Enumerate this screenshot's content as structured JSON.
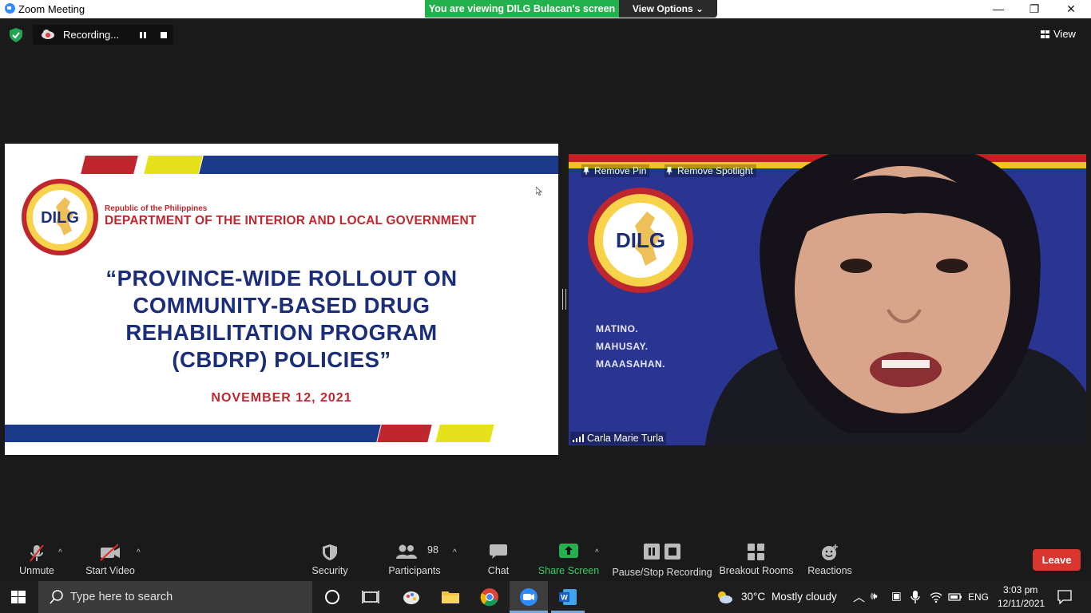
{
  "window": {
    "title": "Zoom Meeting",
    "viewing_banner": "You are viewing DILG Bulacan's screen",
    "view_options": "View Options",
    "minimize": "—",
    "restore": "❐",
    "close": "✕"
  },
  "recording": {
    "label": "Recording..."
  },
  "view_button": {
    "label": "View"
  },
  "slide": {
    "seal_text": "DILG",
    "republic": "Republic of the Philippines",
    "department": "DEPARTMENT OF THE INTERIOR AND LOCAL GOVERNMENT",
    "headline_lines": [
      "“PROVINCE-WIDE ROLLOUT ON",
      "COMMUNITY-BASED DRUG",
      "REHABILITATION PROGRAM",
      "(CBDRP) POLICIES”"
    ],
    "date": "NOVEMBER 12, 2021"
  },
  "video": {
    "seal_text": "DILG",
    "motto": [
      "MATINO.",
      "MAHUSAY.",
      "MAAASAHAN."
    ],
    "remove_pin": "Remove Pin",
    "remove_spotlight": "Remove Spotlight",
    "participant_name": "Carla Marie Turla"
  },
  "toolbar": {
    "unmute": "Unmute",
    "start_video": "Start Video",
    "security": "Security",
    "participants": "Participants",
    "participants_count": "98",
    "chat": "Chat",
    "share_screen": "Share Screen",
    "pause_stop": "Pause/Stop Recording",
    "breakout": "Breakout Rooms",
    "reactions": "Reactions",
    "leave": "Leave"
  },
  "taskbar": {
    "search_placeholder": "Type here to search",
    "weather_temp": "30°C",
    "weather_desc": "Mostly cloudy",
    "language": "ENG",
    "time": "3:03 pm",
    "date": "12/11/2021"
  },
  "colors": {
    "share_green": "#22b14c",
    "leave_red": "#d9362f",
    "dilg_red": "#c0262d",
    "dilg_blue": "#1c2d7a",
    "dilg_yellow": "#e5e21c"
  }
}
